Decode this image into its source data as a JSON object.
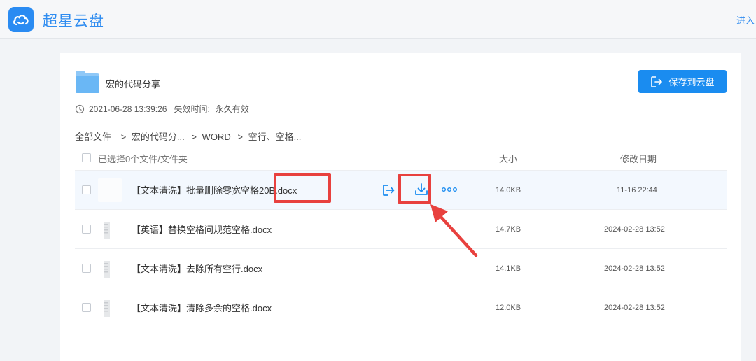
{
  "app": {
    "title": "超星云盘",
    "enter_link": "进入"
  },
  "share": {
    "folder_name": "宏的代码分享",
    "created_time": "2021-06-28 13:39:26",
    "expire_label": "失效时间:",
    "expire_value": "永久有效",
    "save_button": "保存到云盘"
  },
  "breadcrumb": [
    "全部文件",
    ">",
    "宏的代码分...",
    ">",
    "WORD",
    ">",
    "空行、空格..."
  ],
  "table": {
    "selected_label": "已选择0个文件/文件夹",
    "col_size": "大小",
    "col_date": "修改日期",
    "rows": [
      {
        "name": "【文本清洗】批量删除零宽空格20",
        "name_tail": "B.docx",
        "size": "14.0KB",
        "date": "11-16 22:44"
      },
      {
        "name": "【英语】替换空格问规范空格.docx",
        "size": "14.7KB",
        "date": "2024-02-28 13:52"
      },
      {
        "name": "【文本清洗】去除所有空行.docx",
        "size": "14.1KB",
        "date": "2024-02-28 13:52"
      },
      {
        "name": "【文本清洗】清除多余的空格.docx",
        "size": "12.0KB",
        "date": "2024-02-28 13:52"
      }
    ]
  },
  "icons": {
    "logo": "cloud-icon",
    "clock": "clock-icon",
    "save": "export-icon",
    "download": "download-icon",
    "more": "more-dots-icon"
  },
  "colors": {
    "accent": "#1a8cf0",
    "highlight": "#e8413e"
  }
}
